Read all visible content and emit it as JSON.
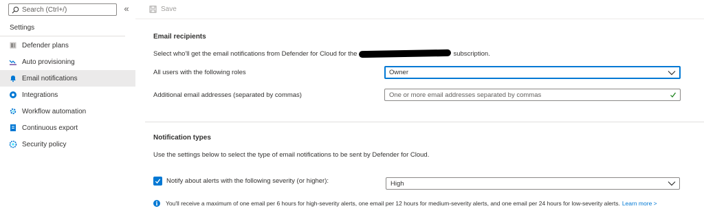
{
  "sidebar": {
    "search_placeholder": "Search (Ctrl+/)",
    "collapse_glyph": "«",
    "header": "Settings",
    "items": [
      {
        "label": "Defender plans",
        "icon": "defender-plans-icon"
      },
      {
        "label": "Auto provisioning",
        "icon": "auto-provisioning-icon"
      },
      {
        "label": "Email notifications",
        "icon": "email-notifications-icon",
        "selected": true
      },
      {
        "label": "Integrations",
        "icon": "integrations-icon"
      },
      {
        "label": "Workflow automation",
        "icon": "workflow-automation-icon"
      },
      {
        "label": "Continuous export",
        "icon": "continuous-export-icon"
      },
      {
        "label": "Security policy",
        "icon": "security-policy-icon"
      }
    ]
  },
  "toolbar": {
    "save_label": "Save"
  },
  "email_recipients": {
    "title": "Email recipients",
    "description_prefix": "Select who'll get the email notifications from Defender for Cloud for the",
    "description_suffix": "subscription.",
    "roles_label": "All users with the following roles",
    "roles_value": "Owner",
    "additional_label": "Additional email addresses (separated by commas)",
    "additional_placeholder": "One or more email addresses separated by commas"
  },
  "notification_types": {
    "title": "Notification types",
    "description": "Use the settings below to select the type of email notifications to be sent by Defender for Cloud.",
    "alerts_checkbox_label": "Notify about alerts with the following severity (or higher):",
    "alerts_checked": true,
    "severity_value": "High",
    "info_text": "You'll receive a maximum of one email per 6 hours for high-severity alerts, one email per 12 hours for medium-severity alerts, and one email per 24 hours for low-severity alerts.",
    "learn_more": "Learn more >"
  },
  "colors": {
    "accent": "#0078d4",
    "selected_bg": "#ebeaea",
    "valid_check": "#107c10"
  }
}
